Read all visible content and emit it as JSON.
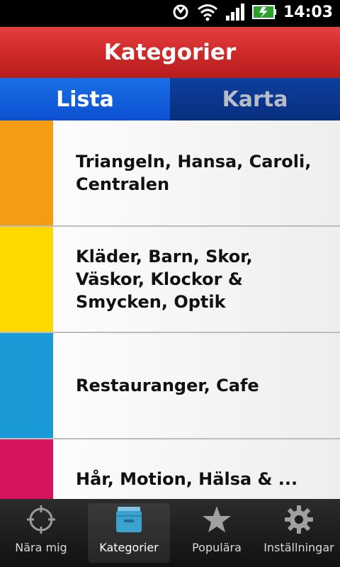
{
  "statusbar": {
    "time": "14:03"
  },
  "header": {
    "title": "Kategorier"
  },
  "tabs": [
    {
      "label": "Lista",
      "active": true
    },
    {
      "label": "Karta",
      "active": false
    }
  ],
  "categories": [
    {
      "label": "Triangeln, Hansa, Caroli, Centralen",
      "color": "#F59B14"
    },
    {
      "label": "Kläder, Barn, Skor, Väskor, Klockor & Smycken, Optik",
      "color": "#FFD900"
    },
    {
      "label": "Restauranger, Cafe",
      "color": "#1A9BD7"
    },
    {
      "label": "Hår, Motion, Hälsa & ...",
      "color": "#D6135F"
    }
  ],
  "bottomnav": [
    {
      "label": "Nära mig",
      "icon": "crosshair-icon"
    },
    {
      "label": "Kategorier",
      "icon": "folder-icon",
      "active": true
    },
    {
      "label": "Populära",
      "icon": "star-icon"
    },
    {
      "label": "Inställningar",
      "icon": "gear-icon"
    }
  ]
}
